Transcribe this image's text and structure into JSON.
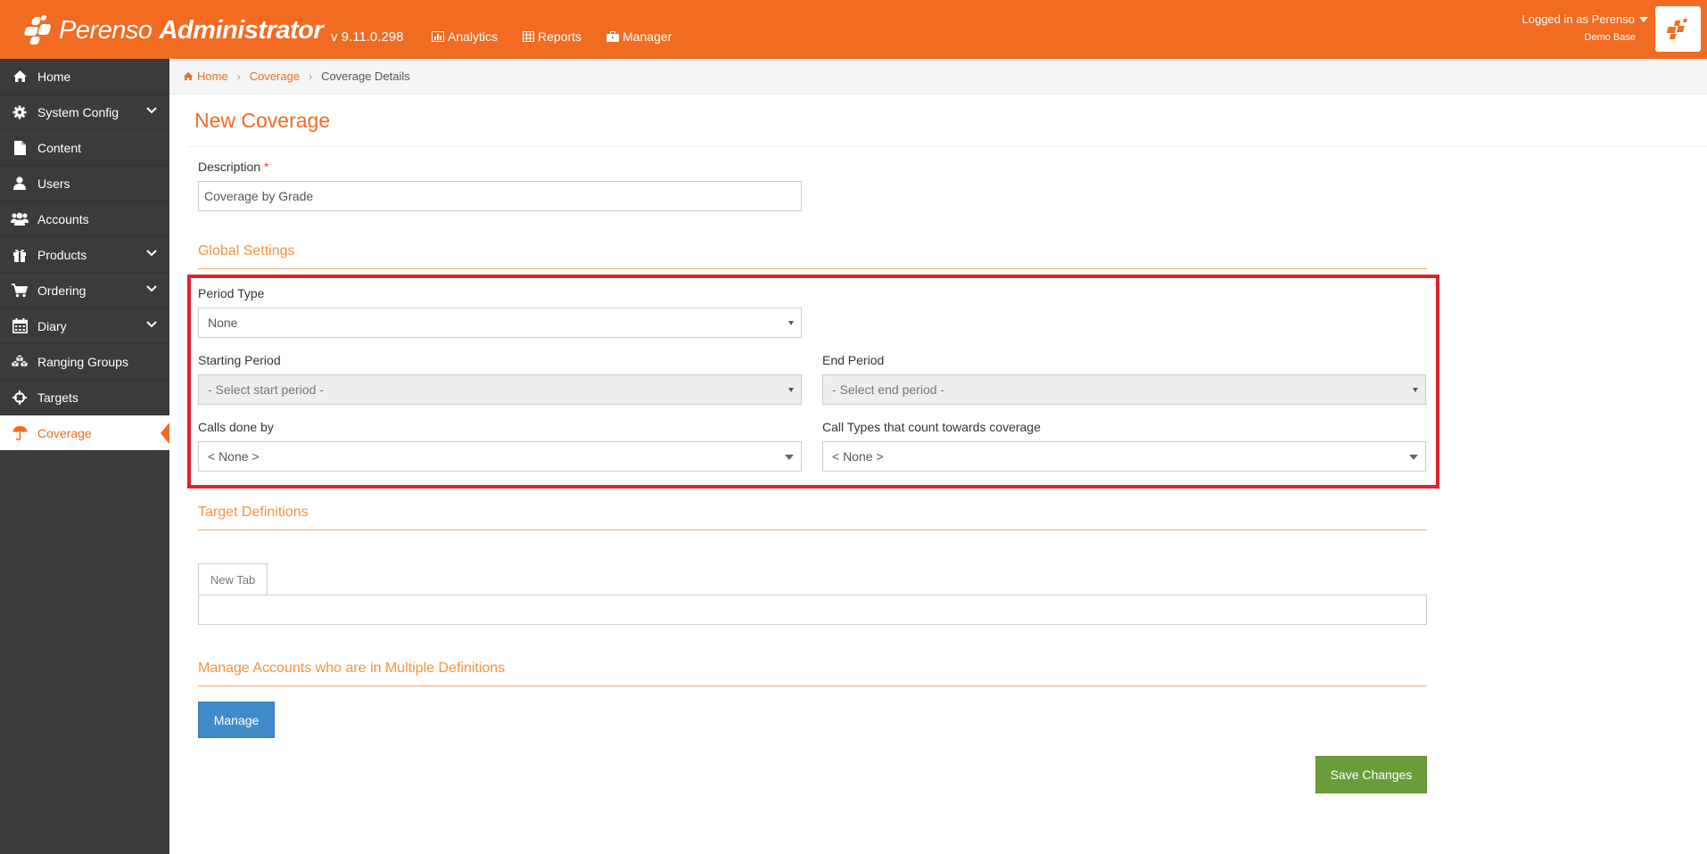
{
  "header": {
    "brand_light": "Perenso",
    "brand_bold": "Administrator",
    "version": "v 9.11.0.298",
    "nav": [
      {
        "label": "Analytics",
        "icon": "chart-icon"
      },
      {
        "label": "Reports",
        "icon": "table-icon"
      },
      {
        "label": "Manager",
        "icon": "briefcase-icon"
      }
    ],
    "user": "Logged in as Perenso",
    "database": "Demo Base",
    "accent": "#f26b22"
  },
  "sidebar": {
    "items": [
      {
        "label": "Home",
        "icon": "home-icon",
        "expandable": false
      },
      {
        "label": "System Config",
        "icon": "gear-icon",
        "expandable": true
      },
      {
        "label": "Content",
        "icon": "file-icon",
        "expandable": false
      },
      {
        "label": "Users",
        "icon": "user-icon",
        "expandable": false
      },
      {
        "label": "Accounts",
        "icon": "group-icon",
        "expandable": false
      },
      {
        "label": "Products",
        "icon": "gift-icon",
        "expandable": true
      },
      {
        "label": "Ordering",
        "icon": "cart-icon",
        "expandable": true
      },
      {
        "label": "Diary",
        "icon": "calendar-icon",
        "expandable": true
      },
      {
        "label": "Ranging Groups",
        "icon": "cubes-icon",
        "expandable": false
      },
      {
        "label": "Targets",
        "icon": "crosshairs-icon",
        "expandable": false
      },
      {
        "label": "Coverage",
        "icon": "umbrella-icon",
        "expandable": false,
        "active": true
      }
    ]
  },
  "breadcrumb": {
    "home": "Home",
    "parent": "Coverage",
    "current": "Coverage Details"
  },
  "page": {
    "title": "New Coverage"
  },
  "form": {
    "description_label": "Description",
    "required_mark": "*",
    "description_value": "Coverage by Grade",
    "global_settings_title": "Global Settings",
    "period_type_label": "Period Type",
    "period_type_value": "None",
    "starting_period_label": "Starting Period",
    "starting_period_value": "- Select start period -",
    "end_period_label": "End Period",
    "end_period_value": "- Select end period -",
    "calls_done_by_label": "Calls done by",
    "calls_done_by_value": "< None >",
    "call_types_label": "Call Types that count towards coverage",
    "call_types_value": "< None >",
    "target_definitions_title": "Target Definitions",
    "new_tab_label": "New Tab",
    "manage_accounts_title": "Manage Accounts who are in Multiple Definitions",
    "manage_button": "Manage",
    "save_button": "Save Changes"
  }
}
